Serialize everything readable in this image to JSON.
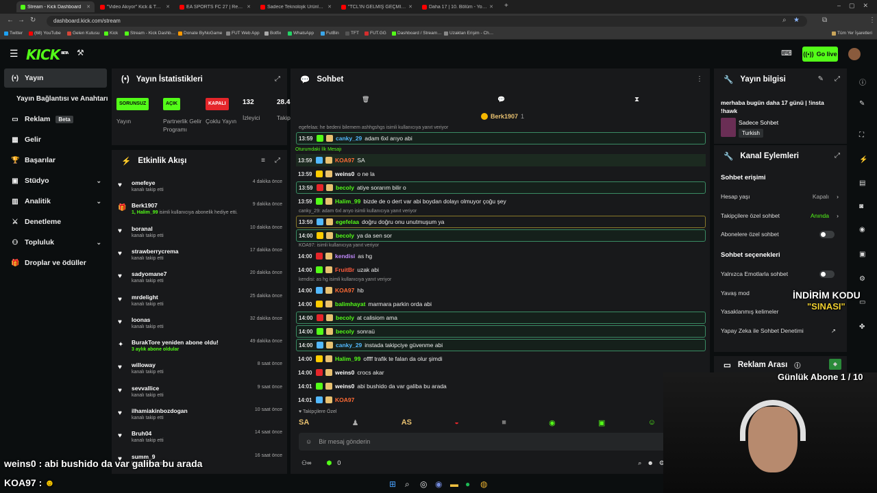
{
  "browser": {
    "tabs": [
      {
        "title": "Stream - Kick Dashboard",
        "color": "#53fc18"
      },
      {
        "title": "\"Video Akıyor\" Kick & Twitch K…",
        "color": "#ff0000"
      },
      {
        "title": "EA SPORTS FC 27 | Resmi Footb…",
        "color": "#ff0000"
      },
      {
        "title": "Sadece Teknolojik Ürünleri Topl…",
        "color": "#ff0000"
      },
      {
        "title": "\"TCL'İN GELMİŞ GEÇMİŞ EN İYİ…",
        "color": "#ff0000"
      },
      {
        "title": "Daha 17 | 10. Bölüm - YouTube",
        "color": "#ff0000"
      }
    ],
    "url": "dashboard.kick.com/stream",
    "bookmarks": [
      "Twitter",
      "(68) YouTube",
      "Gelen Kutusu",
      "Kick",
      "Stream - Kick Dashb…",
      "Donate ByNoGame",
      "FUT Web App",
      "Botfix",
      "WhatsApp",
      "FutBin",
      "TFT",
      "FUT.GG",
      "Dashboard / Stream…",
      "Uzaktan Erişim - Ch…"
    ],
    "all_bookmarks": "Tüm Yer İşaretleri"
  },
  "header": {
    "logo": "KICK",
    "logo_sup": "BETA",
    "go_live": "Go live"
  },
  "sidebar": {
    "items": [
      {
        "label": "Yayın",
        "icon": "broadcast-icon",
        "active": true
      },
      {
        "label": "Yayın Bağlantısı ve Anahtarı",
        "icon": ""
      },
      {
        "label": "Reklam",
        "icon": "tv-icon",
        "badge": "Beta"
      },
      {
        "label": "Gelir",
        "icon": "grid-icon"
      },
      {
        "label": "Başarılar",
        "icon": "trophy-icon"
      },
      {
        "label": "Stüdyo",
        "icon": "monitor-icon",
        "chevron": true
      },
      {
        "label": "Analitik",
        "icon": "chart-icon",
        "chevron": true
      },
      {
        "label": "Denetleme",
        "icon": "sword-icon"
      },
      {
        "label": "Topluluk",
        "icon": "people-icon",
        "chevron": true
      },
      {
        "label": "Droplar ve ödüller",
        "icon": "gift-icon"
      }
    ]
  },
  "stats": {
    "title": "Yayın İstatistikleri",
    "items": [
      {
        "value": "SORUNSUZ",
        "label": "Yayın",
        "color": "#53fc18"
      },
      {
        "value": "AÇIK",
        "label": "Partnerlik Gelir Programı",
        "color": "#53fc18"
      },
      {
        "value": "KAPALI",
        "label": "Çoklu Yayın",
        "color": "#e5262a"
      },
      {
        "value": "132",
        "label": "İzleyici",
        "color": ""
      },
      {
        "value": "28.4",
        "label": "Takip",
        "color": ""
      }
    ]
  },
  "activity": {
    "title": "Etkinlik Akışı",
    "items": [
      {
        "name": "omefeye",
        "sub": "kanalı takip etti",
        "time": "4 dakika önce",
        "icon": "heart"
      },
      {
        "name": "Berk1907",
        "sub_hl": "1, Halim_99",
        "sub": " isimli kullanıcıya abonelik hediye etti.",
        "time": "9 dakika önce",
        "icon": "gift"
      },
      {
        "name": "boranal",
        "sub": "kanalı takip etti",
        "time": "10 dakika önce",
        "icon": "heart"
      },
      {
        "name": "strawberrycrema",
        "sub": "kanalı takip etti",
        "time": "17 dakika önce",
        "icon": "heart"
      },
      {
        "name": "sadyomane7",
        "sub": "kanalı takip etti",
        "time": "20 dakika önce",
        "icon": "heart"
      },
      {
        "name": "mrdelight",
        "sub": "kanalı takip etti",
        "time": "25 dakika önce",
        "icon": "heart"
      },
      {
        "name": "loonas",
        "sub": "kanalı takip etti",
        "time": "32 dakika önce",
        "icon": "heart"
      },
      {
        "name": "BurakTore yeniden abone oldu!",
        "sub_hl": "3 aylık abone oldular",
        "sub": "",
        "time": "49 dakika önce",
        "icon": "star"
      },
      {
        "name": "willoway",
        "sub": "kanalı takip etti",
        "time": "8 saat önce",
        "icon": "heart"
      },
      {
        "name": "sevvallice",
        "sub": "kanalı takip etti",
        "time": "9 saat önce",
        "icon": "heart"
      },
      {
        "name": "ilhamiakinbozdogan",
        "sub": "kanalı takip etti",
        "time": "10 saat önce",
        "icon": "heart"
      },
      {
        "name": "Bruh04",
        "sub": "kanalı takip etti",
        "time": "14 saat önce",
        "icon": "heart"
      },
      {
        "name": "summ_9",
        "sub": "kanalı takip etti",
        "time": "16 saat önce",
        "icon": "heart"
      }
    ]
  },
  "chat": {
    "title": "Sohbet",
    "pinned_user": "Berk1907",
    "pinned_count": "1",
    "first_msg_label": "Oturumdaki İlk Mesajı",
    "input_placeholder": "Bir mesaj gönderin",
    "followers_label": "Takipçilere Özel",
    "bottom_count": "0",
    "messages": [
      {
        "reply": "egefelaa: he bedeni bilemem ashhgshgs isimli kullanıcıya yanıt veriyor",
        "time": "13:59",
        "user": "canky_29",
        "color": "#53b9ff",
        "text": "adam 6xl arıyo abi",
        "hl": true
      },
      {
        "time": "13:59",
        "user": "KOA97",
        "color": "#ff6b35",
        "text": "SA",
        "first": true
      },
      {
        "time": "13:59",
        "user": "weins0",
        "color": "#ffffff",
        "text": "o ne la"
      },
      {
        "time": "13:59",
        "user": "becoly",
        "color": "#53fc18",
        "text": "atiye sorarım bilir o",
        "hl": true
      },
      {
        "time": "13:59",
        "user": "Halim_99",
        "color": "#53fc18",
        "text": "bizde de o dert var abi boydan dolayı olmuyor çoğu şey"
      },
      {
        "reply": "canky_29: adam 6xl arıyo isimli kullanıcıya yanıt veriyor",
        "time": "13:59",
        "user": "egefelaa",
        "color": "#53fc18",
        "text": "doğru doğru onu unutmuşum ya",
        "hly": true
      },
      {
        "time": "14:00",
        "user": "becoly",
        "color": "#53fc18",
        "text": "ya da sen sor",
        "hl": true
      },
      {
        "reply": "KOA97: isimli kullanıcıya yanıt veriyor",
        "time": "14:00",
        "user": "kendisi",
        "color": "#c38bff",
        "text": "as hg"
      },
      {
        "time": "14:00",
        "user": "FruitBr",
        "color": "#ff5a3c",
        "text": "uzak abi"
      },
      {
        "reply": "kendisi: as hg isimli kullanıcıya yanıt veriyor",
        "time": "14:00",
        "user": "KOA97",
        "color": "#ff6b35",
        "text": "hb"
      },
      {
        "time": "14:00",
        "user": "balimhayat",
        "color": "#53fc18",
        "text": "marmara parkin orda abi"
      },
      {
        "time": "14:00",
        "user": "becoly",
        "color": "#53fc18",
        "text": "at calisiom ama",
        "hl": true
      },
      {
        "time": "14:00",
        "user": "becoly",
        "color": "#53fc18",
        "text": "sonraü",
        "hl": true
      },
      {
        "time": "14:00",
        "user": "canky_29",
        "color": "#53b9ff",
        "text": "instada takipciye güvenme abi",
        "hl": true
      },
      {
        "time": "14:00",
        "user": "Halim_99",
        "color": "#53fc18",
        "text": "offff trafik te falan da olur şimdi"
      },
      {
        "time": "14:00",
        "user": "weins0",
        "color": "#ffffff",
        "text": "crocs akar"
      },
      {
        "time": "14:01",
        "user": "weins0",
        "color": "#ffffff",
        "text": "abi bushido da var galiba bu arada"
      },
      {
        "time": "14:01",
        "user": "KOA97",
        "color": "#ff6b35",
        "text": ""
      }
    ]
  },
  "stream_info": {
    "title": "Yayın bilgisi",
    "stream_title": "merhaba bugün daha 17 günü | !insta !hawk",
    "category": "Sadece Sohbet",
    "language": "Turkish"
  },
  "channel_actions": {
    "title": "Kanal Eylemleri",
    "chat_access": "Sohbet erişimi",
    "rows": [
      {
        "label": "Hesap yaşı",
        "value": "Kapalı"
      },
      {
        "label": "Takipçilere özel sohbet",
        "value": "Anında"
      },
      {
        "label": "Abonelere özel sohbet",
        "value": ""
      }
    ],
    "chat_options": "Sohbet seçenekleri",
    "rows2": [
      {
        "label": "Yalnızca Emotlarla sohbet"
      },
      {
        "label": "Yavaş mod"
      },
      {
        "label": "Yasaklanmış kelimeler"
      },
      {
        "label": "Yapay Zeka ile Sohbet Denetimi"
      }
    ]
  },
  "ad_break": {
    "title": "Reklam Arası"
  },
  "overlay": {
    "discount_line1": "İNDİRİM KODU",
    "discount_line2": "\"SINASI\"",
    "daily_subs": "Günlük Abone 1 / 10",
    "caption1": "weins0 : abi bushido da var galiba bu arada",
    "caption2": "KOA97 :"
  }
}
